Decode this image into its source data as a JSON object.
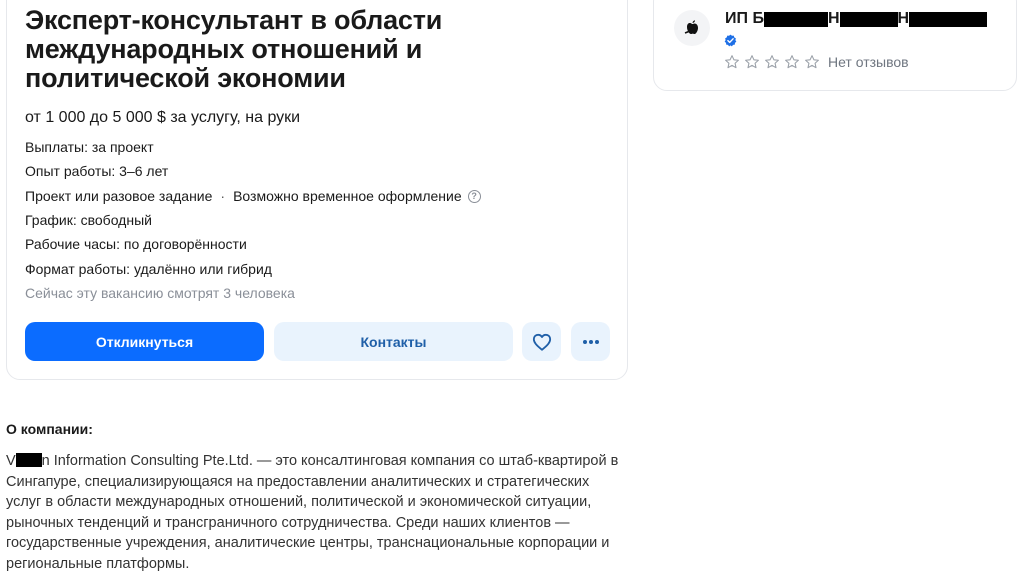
{
  "vacancy": {
    "title": "Эксперт-консультант в области международных отношений и политической экономии",
    "salary": "от 1 000 до 5 000 $ за услугу, на руки",
    "payments": "Выплаты: за проект",
    "experience": "Опыт работы: 3–6 лет",
    "employment_type": "Проект или разовое задание",
    "employment_extra": "Возможно временное оформление",
    "schedule": "График: свободный",
    "working_hours": "Рабочие часы: по договорённости",
    "work_format": "Формат работы: удалённо или гибрид",
    "viewers": "Сейчас эту вакансию смотрят 3 человека",
    "respond_label": "Откликнуться",
    "contacts_label": "Контакты"
  },
  "company": {
    "name_prefix": "ИП Б",
    "name_part2": "Н",
    "name_part3": "Н",
    "rating_stars": 0,
    "reviews_text": "Нет отзывов"
  },
  "about": {
    "heading": "О компании:",
    "name_first_letter": "V",
    "text": "n Information Consulting Pte.Ltd. — это консалтинговая компания со штаб-квартирой в Сингапуре, специализирующаяся на предоставлении аналитических и стратегических услуг в области международных отношений, политической и экономической ситуации, рыночных тенденций и трансграничного сотрудничества. Среди наших клиентов — государственные учреждения, аналитические центры, транснациональные корпорации и региональные платформы."
  },
  "colors": {
    "primary": "#0b6cff",
    "secondary_bg": "#e9f3fd",
    "verified": "#1e6fe6"
  },
  "icons": [
    "help-icon",
    "heart-icon",
    "more-icon",
    "verified-icon",
    "star-icon"
  ]
}
